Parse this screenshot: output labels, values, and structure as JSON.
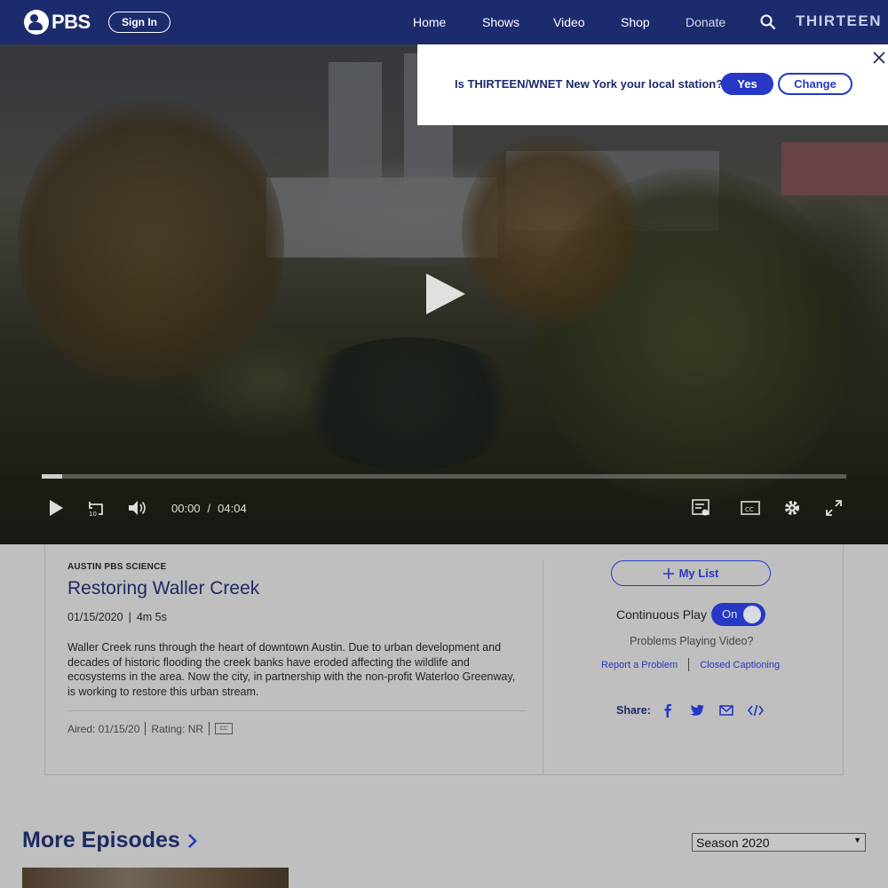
{
  "header": {
    "logo_text": "PBS",
    "sign_in": "Sign In",
    "nav": [
      "Home",
      "Shows",
      "Video",
      "Shop",
      "Donate"
    ],
    "station": "THIRTEEN"
  },
  "popup": {
    "question": "Is THIRTEEN/WNET New York your local station?",
    "yes": "Yes",
    "change": "Change"
  },
  "player": {
    "current_time": "00:00",
    "separator": "/",
    "duration": "04:04",
    "progress": 0.025
  },
  "episode": {
    "show": "AUSTIN PBS SCIENCE",
    "title": "Restoring Waller Creek",
    "date": "01/15/2020",
    "divider": "|",
    "length": "4m 5s",
    "description": "Waller Creek runs through the heart of downtown Austin. Due to urban development and decades of historic flooding the creek banks have eroded affecting the wildlife and ecosystems in the area. Now the city, in partnership with the non-profit Waterloo Greenway, is working to restore this urban stream.",
    "aired": "Aired: 01/15/20",
    "rating": "Rating: NR",
    "cc": "CC"
  },
  "side": {
    "my_list": "My List",
    "continuous_play": "Continuous Play",
    "toggle": "On",
    "problems": "Problems Playing Video?",
    "report": "Report a Problem",
    "closed_captioning": "Closed Captioning",
    "share": "Share:"
  },
  "more": {
    "title": "More Episodes",
    "season": "Season 2020"
  }
}
